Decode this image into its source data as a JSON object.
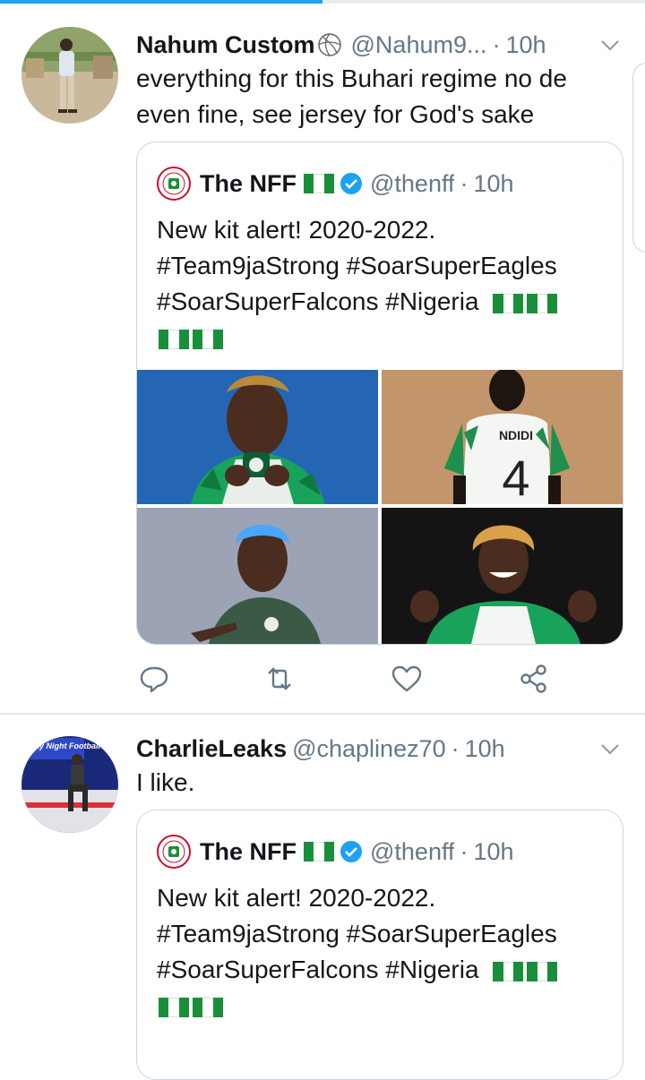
{
  "progress": {
    "fraction": 0.5,
    "color": "#1da1f2"
  },
  "colors": {
    "text": "#14171a",
    "secondary": "#657786",
    "border": "#ccd6dd",
    "verified": "#1da1f2",
    "flag_green": "#1a8f3a"
  },
  "tweets": [
    {
      "name": "Nahum Custom",
      "name_emoji": "volleyball-icon",
      "handle": "@Nahum9...",
      "separator": "·",
      "time": "10h",
      "text": "everything for this Buhari regime no de even fine, see jersey for God's sake",
      "quote": {
        "name": "The NFF",
        "handle": "@thenff",
        "separator": "·",
        "time": "10h",
        "text_lines": [
          "New kit alert! 2020-2022.",
          "#Team9jaStrong #SoarSuperEagles",
          "#SoarSuperFalcons #Nigeria"
        ],
        "media": [
          "player-kissing-badge-photo",
          "player-back-jersey-photo",
          "player-blue-hair-photo",
          "player-smiling-fists-photo"
        ],
        "jersey_name": "NDIDI",
        "jersey_number": "4"
      },
      "actions": [
        "reply-icon",
        "retweet-icon",
        "like-icon",
        "share-icon"
      ]
    },
    {
      "name": "CharlieLeaks",
      "handle": "@chaplinez70",
      "separator": "·",
      "time": "10h",
      "text": "I like.",
      "avatar_sign": "nday Night Football",
      "quote": {
        "name": "The NFF",
        "handle": "@thenff",
        "separator": "·",
        "time": "10h",
        "text_lines": [
          "New kit alert! 2020-2022.",
          "#Team9jaStrong #SoarSuperEagles",
          "#SoarSuperFalcons #Nigeria"
        ]
      }
    }
  ]
}
